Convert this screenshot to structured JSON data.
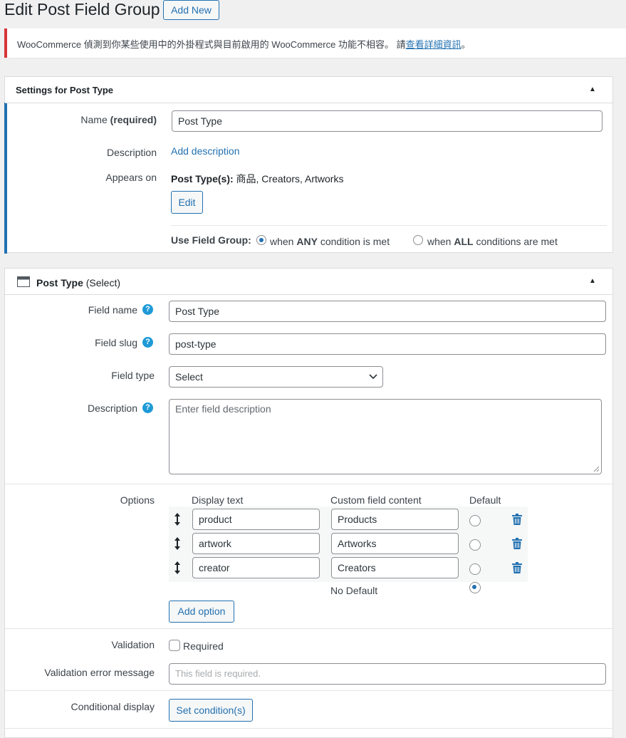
{
  "header": {
    "title": "Edit Post Field Group",
    "add_new": "Add New"
  },
  "notice": {
    "text": "WooCommerce 偵測到你某些使用中的外掛程式與目前啟用的 WooCommerce 功能不相容。 請",
    "link": "查看詳細資訊",
    "suffix": "。"
  },
  "settings_box": {
    "title": "Settings for Post Type",
    "name_label": "Name",
    "name_required": "(required)",
    "name_value": "Post Type",
    "description_label": "Description",
    "add_description": "Add description",
    "appears_on_label": "Appears on",
    "post_types_label": "Post Type(s):",
    "post_types_value": "商品, Creators, Artworks",
    "edit_button": "Edit",
    "use_field_group_label": "Use Field Group:",
    "any_prefix": "when",
    "any_bold": "ANY",
    "any_suffix": "condition is met",
    "all_prefix": "when",
    "all_bold": "ALL",
    "all_suffix": "conditions are met",
    "selected_condition": "any"
  },
  "field_box": {
    "title": "Post Type",
    "title_type": "(Select)",
    "field_name_label": "Field name",
    "field_name_value": "Post Type",
    "field_slug_label": "Field slug",
    "field_slug_value": "post-type",
    "field_type_label": "Field type",
    "field_type_value": "Select",
    "description_label": "Description",
    "description_placeholder": "Enter field description",
    "options_label": "Options",
    "col_display": "Display text",
    "col_custom": "Custom field content",
    "col_default": "Default",
    "options": [
      {
        "display": "product",
        "custom": "Products",
        "default": false
      },
      {
        "display": "artwork",
        "custom": "Artworks",
        "default": false
      },
      {
        "display": "creator",
        "custom": "Creators",
        "default": false
      }
    ],
    "no_default_label": "No Default",
    "no_default_selected": true,
    "add_option": "Add option",
    "validation_label": "Validation",
    "required_label": "Required",
    "validation_msg_label": "Validation error message",
    "validation_msg_placeholder": "This field is required.",
    "conditional_label": "Conditional display",
    "set_conditions": "Set condition(s)"
  },
  "colors": {
    "accent": "#2271b1",
    "notice_border": "#d63638",
    "help_icon": "#1e9ad6",
    "settings_left_border": "#2271b1"
  }
}
